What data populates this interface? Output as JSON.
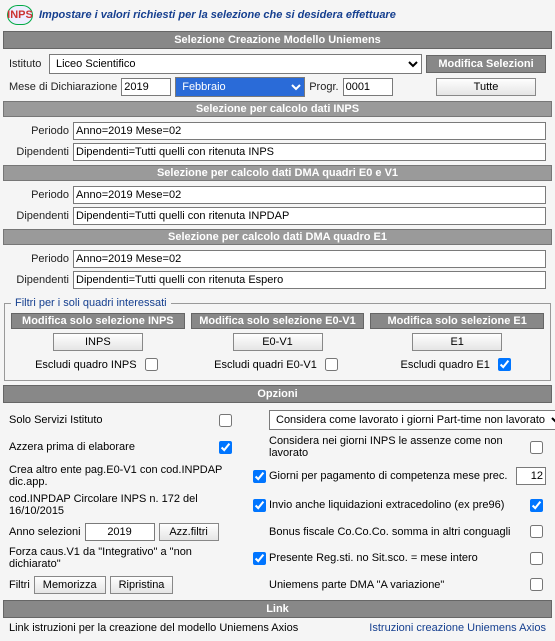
{
  "banner": {
    "logo_text": "INPS",
    "instruction": "Impostare i valori richiesti per la selezione che si desidera effettuare"
  },
  "main": {
    "title": "Selezione Creazione Modello Uniemens",
    "istituto_label": "Istituto",
    "istituto_value": "Liceo Scientifico",
    "modifica_selezioni_title": "Modifica Selezioni",
    "tutte_btn": "Tutte",
    "mese_label": "Mese di Dichiarazione",
    "anno": "2019",
    "mese": "Febbraio",
    "progr_label": "Progr.",
    "progr_value": "0001"
  },
  "inps_sel": {
    "title": "Selezione per calcolo dati INPS",
    "periodo_label": "Periodo",
    "periodo_value": "Anno=2019 Mese=02",
    "dipendenti_label": "Dipendenti",
    "dipendenti_value": "Dipendenti=Tutti quelli con ritenuta INPS"
  },
  "dma_e0v1": {
    "title": "Selezione per calcolo dati DMA quadri E0 e V1",
    "periodo_label": "Periodo",
    "periodo_value": "Anno=2019 Mese=02",
    "dipendenti_label": "Dipendenti",
    "dipendenti_value": "Dipendenti=Tutti quelli con ritenuta INPDAP"
  },
  "dma_e1": {
    "title": "Selezione per calcolo dati DMA quadro E1",
    "periodo_label": "Periodo",
    "periodo_value": "Anno=2019 Mese=02",
    "dipendenti_label": "Dipendenti",
    "dipendenti_value": "Dipendenti=Tutti quelli con ritenuta Espero"
  },
  "filters": {
    "legend": "Filtri per i soli quadri interessati",
    "inps_title": "Modifica solo selezione INPS",
    "inps_btn": "INPS",
    "inps_excl": "Escludi quadro INPS",
    "e0v1_title": "Modifica solo selezione E0-V1",
    "e0v1_btn": "E0-V1",
    "e0v1_excl": "Escludi quadri E0-V1",
    "e1_title": "Modifica solo selezione E1",
    "e1_btn": "E1",
    "e1_excl": "Escludi quadro E1"
  },
  "options": {
    "title": "Opzioni",
    "solo_servizi": "Solo Servizi Istituto",
    "considera_pt": "Considera come lavorato i giorni Part-time non lavorato",
    "azzera": "Azzera prima di elaborare",
    "considera_inps": "Considera nei giorni INPS   le assenze come non lavorato",
    "crea_altro": "Crea altro ente pag.E0-V1 con cod.INPDAP dic.app.",
    "giorni_pag": "Giorni per pagamento di competenza mese prec.",
    "giorni_pag_val": "12",
    "cod_inpdap": "cod.INPDAP Circolare INPS n. 172 del 16/10/2015",
    "invio_liq": "Invio anche liquidazioni extracedolino (ex pre96)",
    "anno_selezioni_label": "Anno selezioni",
    "anno_selezioni_val": "2019",
    "azz_filtri_btn": "Azz.filtri",
    "bonus": "Bonus fiscale Co.Co.Co. somma in altri conguagli",
    "forza": "Forza caus.V1 da \"Integrativo\" a \"non dichiarato\"",
    "presente": "Presente Reg.sti. no Sit.sco. = mese intero",
    "filtri_label": "Filtri",
    "memorizza_btn": "Memorizza",
    "ripristina_btn": "Ripristina",
    "uniemens_a": "Uniemens parte DMA \"A variazione\""
  },
  "link": {
    "title": "Link",
    "left": "Link istruzioni per la creazione del modello Uniemens Axios",
    "right": "Istruzioni creazione Uniemens Axios"
  }
}
